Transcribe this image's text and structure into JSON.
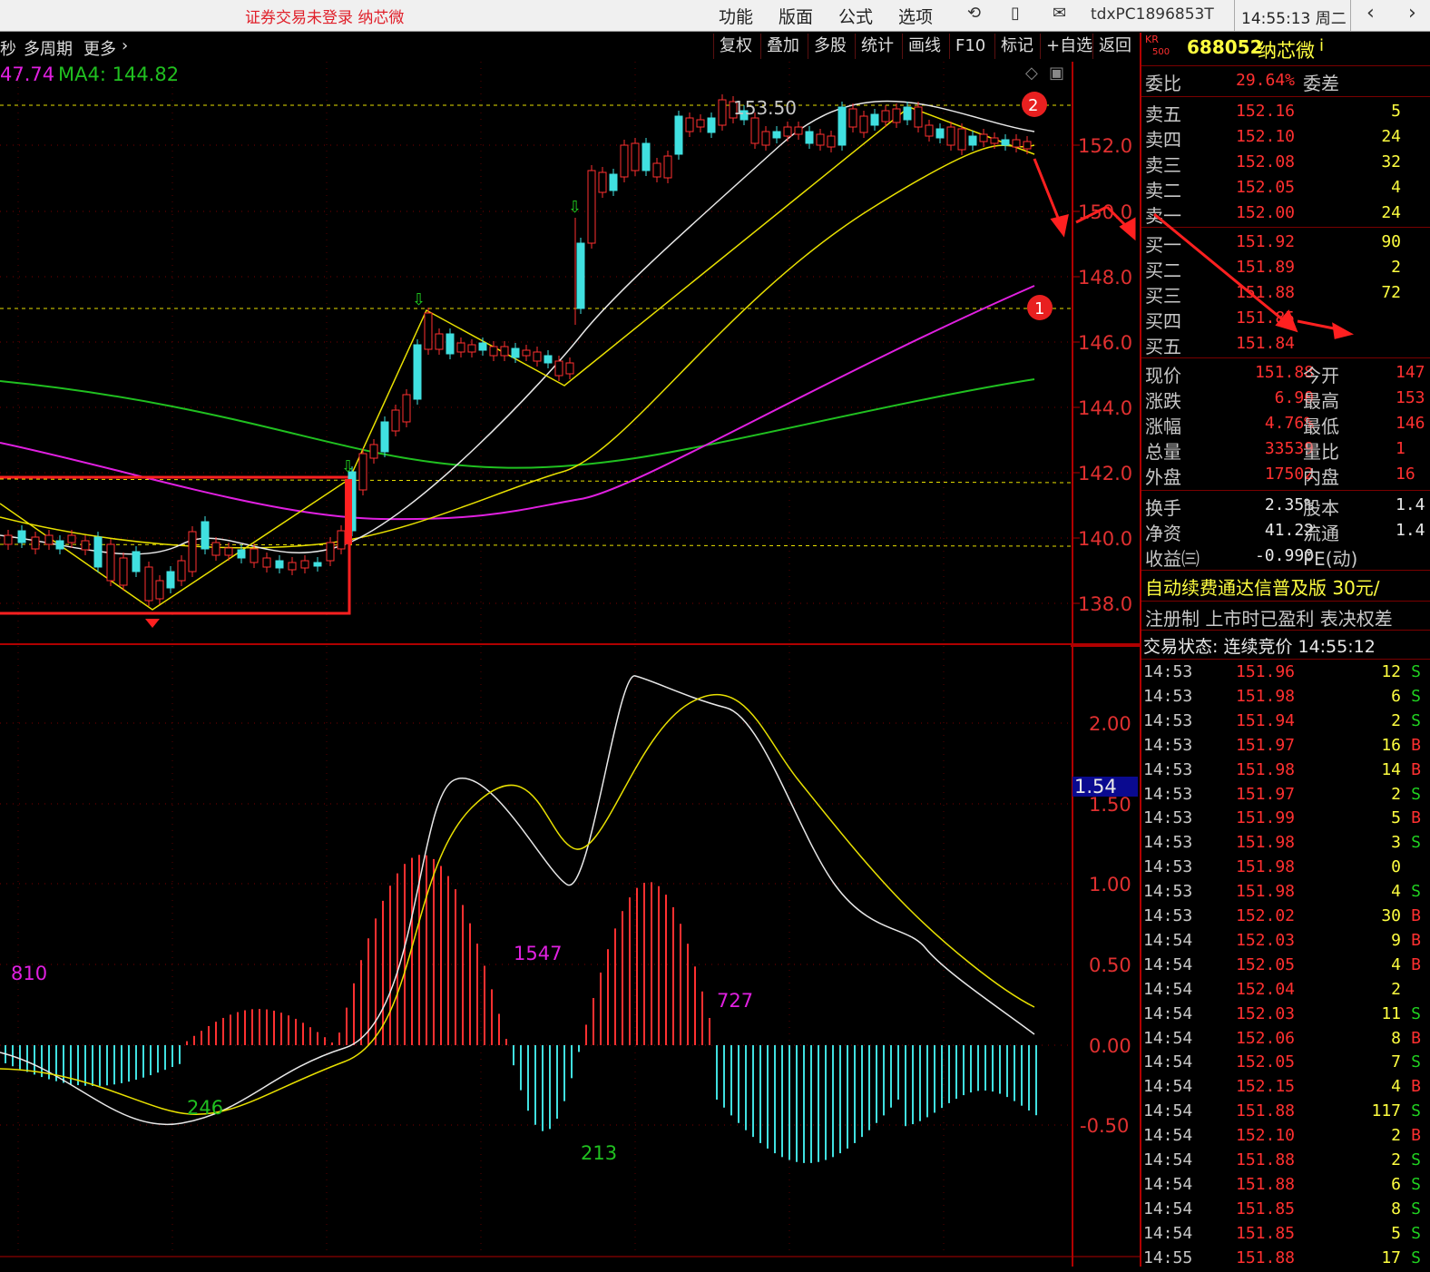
{
  "top_bar": {
    "login_warning": "证券交易未登录  纳芯微",
    "menus": [
      "功能",
      "版面",
      "公式",
      "选项"
    ],
    "user_id": "tdxPC1896853T",
    "clock": "14:55:13 周二"
  },
  "toolbar": {
    "left_partial": "秒",
    "period_label": "多周期",
    "more_label": "更多",
    "buttons": [
      "复权",
      "叠加",
      "多股",
      "统计",
      "画线",
      "F10",
      "标记",
      "+自选",
      "返回"
    ]
  },
  "indicator_header": {
    "text_ma3": "47.74",
    "text_ma4": "MA4: 144.82"
  },
  "main_chart": {
    "price_axis_labels": [
      "152.0",
      "150.0",
      "148.0",
      "146.0",
      "144.0",
      "142.0",
      "140.0",
      "138.0"
    ],
    "high_marker": "153.50",
    "annotations": [
      "2",
      "1"
    ]
  },
  "macd_chart": {
    "axis_labels": [
      "2.00",
      "1.50",
      "1.00",
      "0.50",
      "0.00",
      "-0.50"
    ],
    "current_value": "1.54",
    "area_labels": [
      "810",
      "246",
      "1547",
      "213",
      "727"
    ]
  },
  "stock": {
    "code": "688052",
    "name": "纳芯微",
    "badge_top": "KR",
    "badge_bottom": "500",
    "info_icon": "i"
  },
  "order_book": {
    "weibi_label": "委比",
    "weibi_value": "29.64%",
    "weicha_label": "委差",
    "asks": [
      {
        "label": "卖五",
        "price": "152.16",
        "vol": "5"
      },
      {
        "label": "卖四",
        "price": "152.10",
        "vol": "24"
      },
      {
        "label": "卖三",
        "price": "152.08",
        "vol": "32"
      },
      {
        "label": "卖二",
        "price": "152.05",
        "vol": "4"
      },
      {
        "label": "卖一",
        "price": "152.00",
        "vol": "24"
      }
    ],
    "bids": [
      {
        "label": "买一",
        "price": "151.92",
        "vol": "90"
      },
      {
        "label": "买二",
        "price": "151.89",
        "vol": "2"
      },
      {
        "label": "买三",
        "price": "151.88",
        "vol": "72"
      },
      {
        "label": "买四",
        "price": "151.85",
        "vol": ""
      },
      {
        "label": "买五",
        "price": "151.84",
        "vol": ""
      }
    ]
  },
  "quote": [
    {
      "l": "现价",
      "v": "151.88",
      "l2": "今开",
      "v2": "147"
    },
    {
      "l": "涨跌",
      "v": "6.90",
      "l2": "最高",
      "v2": "153"
    },
    {
      "l": "涨幅",
      "v": "4.76%",
      "l2": "最低",
      "v2": "146"
    },
    {
      "l": "总量",
      "v": "33539",
      "l2": "量比",
      "v2": "1"
    },
    {
      "l": "外盘",
      "v": "17502",
      "l2": "内盘",
      "v2": "16"
    }
  ],
  "fundamentals": [
    {
      "l": "换手",
      "v": "2.35%",
      "l2": "股本",
      "v2": "1.4"
    },
    {
      "l": "净资",
      "v": "41.22",
      "l2": "流通",
      "v2": "1.4"
    },
    {
      "l": "收益㈢",
      "v": "-0.990",
      "l2": "PE(动)",
      "v2": ""
    }
  ],
  "promo": "自动续费通达信普及版  30元/",
  "tags": "注册制 上市时已盈利 表决权差",
  "trade_status": "交易状态: 连续竞价 14:55:12",
  "ticks": [
    {
      "t": "14:53",
      "p": "151.96",
      "v": "12",
      "bs": "S"
    },
    {
      "t": "14:53",
      "p": "151.98",
      "v": "6",
      "bs": "S"
    },
    {
      "t": "14:53",
      "p": "151.94",
      "v": "2",
      "bs": "S"
    },
    {
      "t": "14:53",
      "p": "151.97",
      "v": "16",
      "bs": "B"
    },
    {
      "t": "14:53",
      "p": "151.98",
      "v": "14",
      "bs": "B"
    },
    {
      "t": "14:53",
      "p": "151.97",
      "v": "2",
      "bs": "S"
    },
    {
      "t": "14:53",
      "p": "151.99",
      "v": "5",
      "bs": "B"
    },
    {
      "t": "14:53",
      "p": "151.98",
      "v": "3",
      "bs": "S"
    },
    {
      "t": "14:53",
      "p": "151.98",
      "v": "0",
      "bs": ""
    },
    {
      "t": "14:53",
      "p": "151.98",
      "v": "4",
      "bs": "S"
    },
    {
      "t": "14:53",
      "p": "152.02",
      "v": "30",
      "bs": "B"
    },
    {
      "t": "14:54",
      "p": "152.03",
      "v": "9",
      "bs": "B"
    },
    {
      "t": "14:54",
      "p": "152.05",
      "v": "4",
      "bs": "B"
    },
    {
      "t": "14:54",
      "p": "152.04",
      "v": "2",
      "bs": ""
    },
    {
      "t": "14:54",
      "p": "152.03",
      "v": "11",
      "bs": "S"
    },
    {
      "t": "14:54",
      "p": "152.06",
      "v": "8",
      "bs": "B"
    },
    {
      "t": "14:54",
      "p": "152.05",
      "v": "7",
      "bs": "S"
    },
    {
      "t": "14:54",
      "p": "152.15",
      "v": "4",
      "bs": "B"
    },
    {
      "t": "14:54",
      "p": "151.88",
      "v": "117",
      "bs": "S"
    },
    {
      "t": "14:54",
      "p": "152.10",
      "v": "2",
      "bs": "B"
    },
    {
      "t": "14:54",
      "p": "151.88",
      "v": "2",
      "bs": "S"
    },
    {
      "t": "14:54",
      "p": "151.88",
      "v": "6",
      "bs": "S"
    },
    {
      "t": "14:54",
      "p": "151.85",
      "v": "8",
      "bs": "S"
    },
    {
      "t": "14:54",
      "p": "151.85",
      "v": "5",
      "bs": "S"
    },
    {
      "t": "14:55",
      "p": "151.88",
      "v": "17",
      "bs": "S"
    }
  ],
  "colors": {
    "up": "#ff3030",
    "down": "#40e0e0",
    "ma_white": "#e8e8e8",
    "ma_yellow": "#e8e000",
    "ma_magenta": "#e020e0",
    "ma_green": "#20c020",
    "grid": "#7a0000"
  },
  "icons": [
    "refresh-icon",
    "phone-icon",
    "mail-icon",
    "chevron-left-icon",
    "chevron-right-icon",
    "diamond-icon",
    "window-icon",
    "arrow-down-icon",
    "arrow-up-icon"
  ]
}
